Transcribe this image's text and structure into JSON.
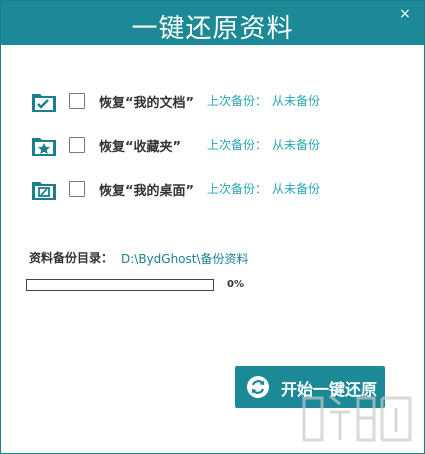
{
  "window": {
    "title": "一键还原资料",
    "close_icon": "×"
  },
  "items": [
    {
      "label": "恢复“我的文档”",
      "last_backup_label": "上次备份：",
      "last_backup_value": "从未备份",
      "checked": false,
      "icon": "folder-check-icon"
    },
    {
      "label": "恢复“收藏夹”",
      "last_backup_label": "上次备份：",
      "last_backup_value": "从未备份",
      "checked": false,
      "icon": "folder-star-icon"
    },
    {
      "label": "恢复“我的桌面”",
      "last_backup_label": "上次备份：",
      "last_backup_value": "从未备份",
      "checked": false,
      "icon": "folder-desktop-icon"
    }
  ],
  "backup_dir": {
    "label": "资料备份目录：",
    "path": "D:\\BydGhost\\备份资料"
  },
  "progress": {
    "percent_label": "0%",
    "value": 0
  },
  "start_button": {
    "label": "开始一键还原",
    "icon": "refresh-icon"
  },
  "colors": {
    "accent": "#1b8a96",
    "link": "#2aa6b6",
    "text": "#333333"
  }
}
